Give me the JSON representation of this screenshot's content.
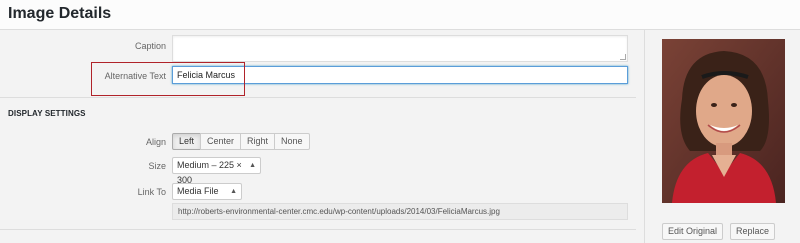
{
  "header": {
    "title": "Image Details"
  },
  "form": {
    "caption_label": "Caption",
    "caption_value": "",
    "alt_label": "Alternative Text",
    "alt_value": "Felicia Marcus"
  },
  "display_settings": {
    "title": "DISPLAY SETTINGS",
    "align_label": "Align",
    "align_options": [
      "Left",
      "Center",
      "Right",
      "None"
    ],
    "align_selected": "Left",
    "size_label": "Size",
    "size_value": "Medium – 225 × 300",
    "link_label": "Link To",
    "link_value": "Media File",
    "link_url": "http://roberts-environmental-center.cmc.edu/wp-content/uploads/2014/03/FeliciaMarcus.jpg"
  },
  "sidebar": {
    "edit_original_label": "Edit Original",
    "replace_label": "Replace"
  },
  "colors": {
    "highlight": "#b0232a",
    "focus": "#5b9dd9"
  },
  "icons": {
    "select_arrow": "up-down-arrows-icon",
    "resize": "resize-grip-icon"
  }
}
